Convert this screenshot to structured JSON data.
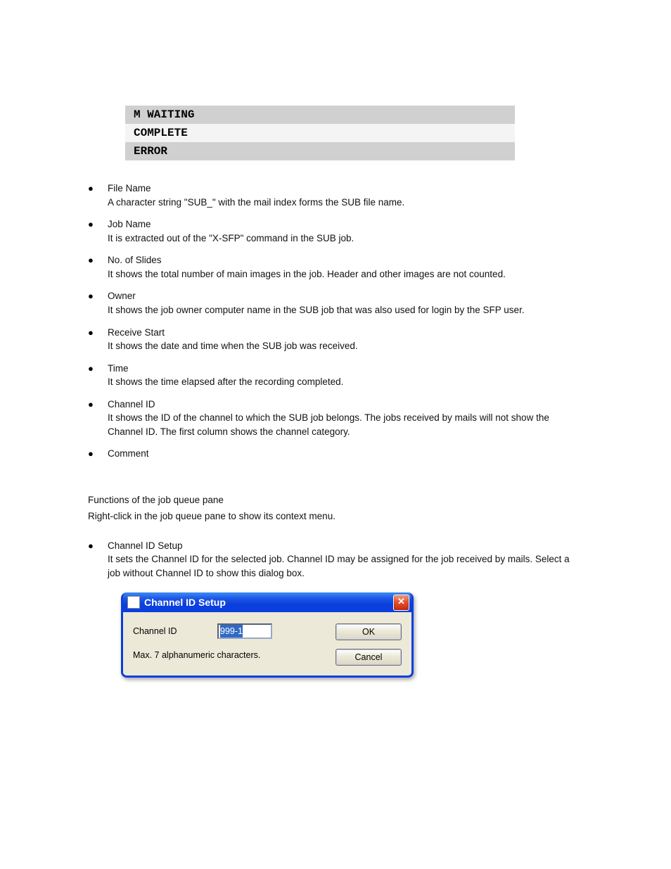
{
  "status_rows": [
    {
      "label": "M WAITING",
      "desc": ""
    },
    {
      "label": "COMPLETE",
      "desc": ""
    },
    {
      "label": "ERROR",
      "desc": ""
    }
  ],
  "bullets": [
    {
      "head": "File Name",
      "body": "A character string \"SUB_\" with the mail index forms the SUB file name."
    },
    {
      "head": "Job Name",
      "body": "It is extracted out of the \"X-SFP\" command in the SUB job."
    },
    {
      "head": "No. of Slides",
      "body": "It shows the total number of main images in the job.  Header and other images are not counted."
    },
    {
      "head": "Owner",
      "body": "It shows the job owner computer name in the SUB job that was also used for login by the SFP user."
    },
    {
      "head": "Receive Start",
      "body": "It shows the date and time when the SUB job was received."
    },
    {
      "head": "Time",
      "body": "It shows the time elapsed after the recording completed."
    },
    {
      "head": "Channel ID",
      "body": "It shows the ID of the channel to which the SUB job belongs.  The jobs received by mails will not show the Channel ID.  The first column shows the channel category."
    },
    {
      "head": "Comment",
      "body": "​"
    }
  ],
  "section_heads": {
    "functions": "Functions of the job queue pane",
    "chid": "Channel ID Setup"
  },
  "section_bodies": {
    "functions": "Right-click in the job queue pane to show its context menu.",
    "chid": "It sets the Channel ID for the selected job.  Channel ID may be assigned for the job received by mails.  Select a job without Channel ID to show this dialog box."
  },
  "dialog": {
    "title": "Channel ID Setup",
    "field_label": "Channel ID",
    "field_value": "999-1",
    "hint": "Max. 7 alphanumeric characters.",
    "ok": "OK",
    "cancel": "Cancel"
  }
}
